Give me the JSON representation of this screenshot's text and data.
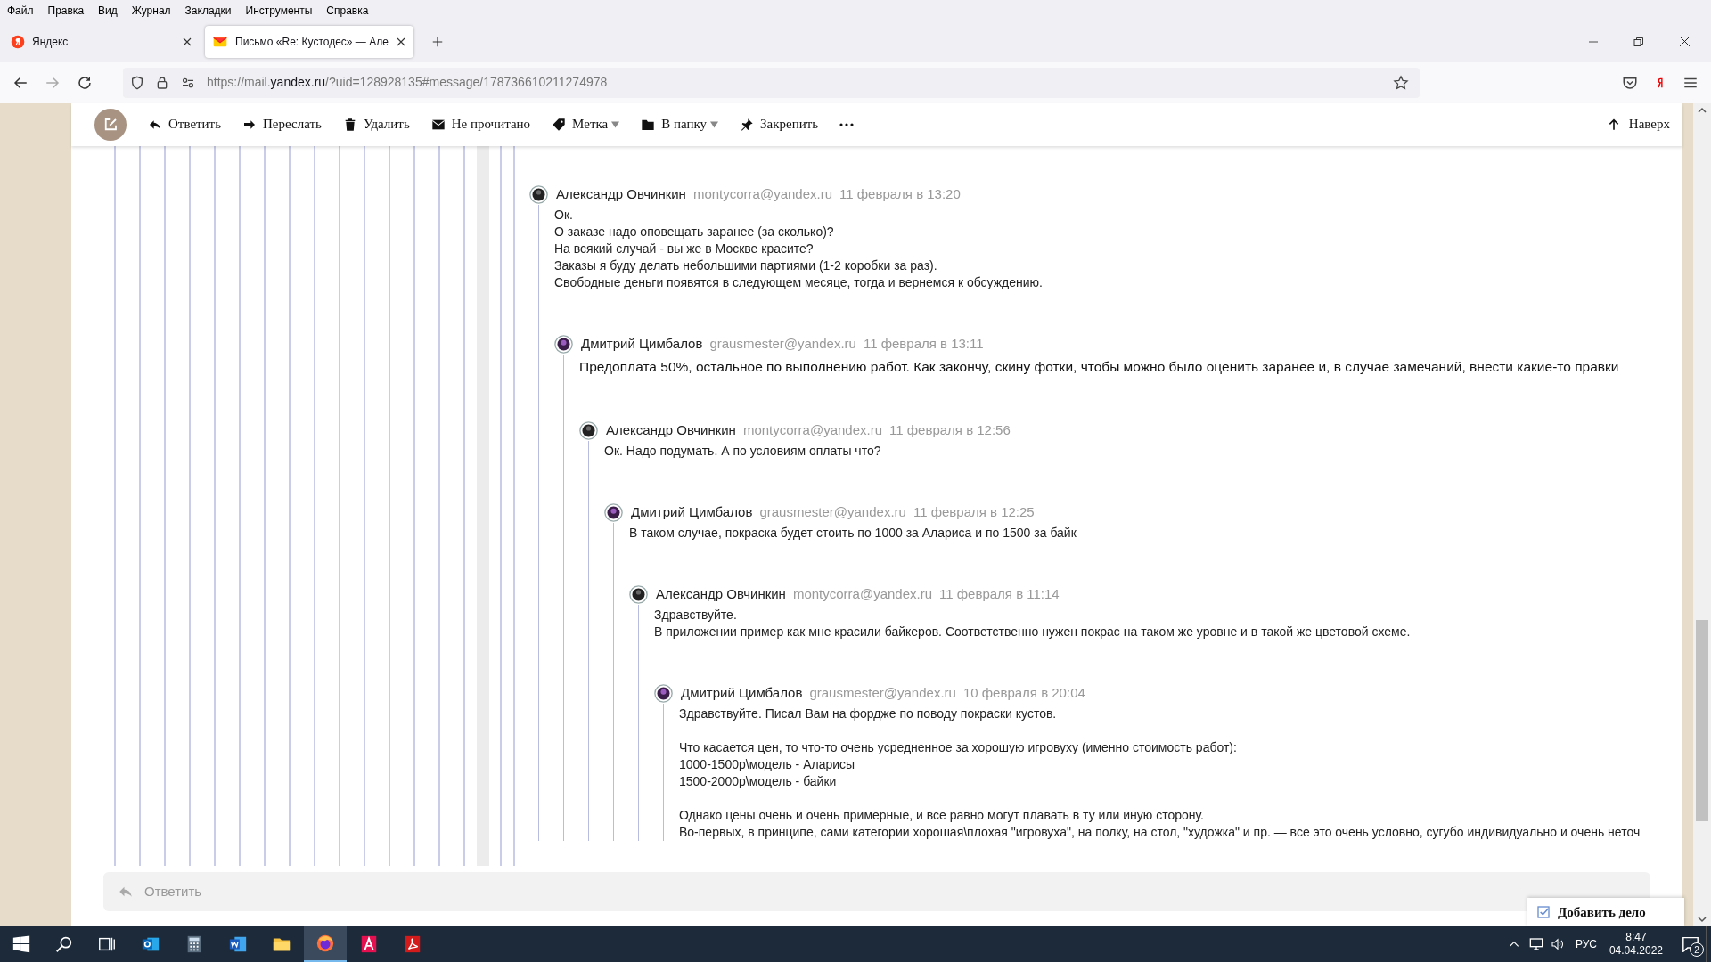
{
  "menu": [
    "Файл",
    "Правка",
    "Вид",
    "Журнал",
    "Закладки",
    "Инструменты",
    "Справка"
  ],
  "tabs": [
    {
      "title": "Яндекс",
      "selected": false
    },
    {
      "title": "Письмо «Re: Кустодес» — Але",
      "selected": true
    }
  ],
  "address": {
    "url_start": "https://mail.",
    "url_domain": "yandex.ru",
    "url_rest": "/?uid=128928135#message/178736610211274978"
  },
  "toolbar": {
    "actions": [
      {
        "label": "Ответить",
        "dropdown": false
      },
      {
        "label": "Переслать",
        "dropdown": false
      },
      {
        "label": "Удалить",
        "dropdown": false
      },
      {
        "label": "Не прочитано",
        "dropdown": false
      },
      {
        "label": "Метка",
        "dropdown": true
      },
      {
        "label": "В папку",
        "dropdown": true
      },
      {
        "label": "Закрепить",
        "dropdown": false
      }
    ],
    "top_label": "Наверх"
  },
  "thread": {
    "author": "Александр Овчинкин",
    "email": "montycorra@yandex.ru",
    "date": "11 февраля в 13:20",
    "large_text": false,
    "paragraphs": [
      [
        "Ок.",
        "О заказе надо оповещать заранее (за сколько)?",
        "На всякий случай - вы же в Москве красите?",
        "Заказы я буду делать небольшими партиями (1-2 коробки за раз).",
        "Свободные деньги появятся в следующем месяце, тогда и вернемся к обсуждению."
      ]
    ],
    "children": [
      {
        "author": "Дмитрий Цимбалов",
        "email": "grausmester@yandex.ru",
        "date": "11 февраля в 13:11",
        "large_text": true,
        "paragraphs": [
          [
            "Предоплата 50%, остальное по выполнению работ. Как закончу, скину фотки, чтобы можно было оценить заранее и, в случае  замечаний, внести какие-то правки"
          ]
        ],
        "children": [
          {
            "author": "Александр Овчинкин",
            "email": "montycorra@yandex.ru",
            "date": "11 февраля в 12:56",
            "large_text": false,
            "paragraphs": [
              [
                "Ок. Надо подумать. А по условиям оплаты что?"
              ]
            ],
            "children": [
              {
                "author": "Дмитрий Цимбалов",
                "email": "grausmester@yandex.ru",
                "date": "11 февраля в 12:25",
                "large_text": false,
                "paragraphs": [
                  [
                    "В таком случае, покраска будет стоить по  1000 за Алариса и по 1500 за байк"
                  ]
                ],
                "children": [
                  {
                    "author": "Александр Овчинкин",
                    "email": "montycorra@yandex.ru",
                    "date": "11 февраля в 11:14",
                    "large_text": false,
                    "paragraphs": [
                      [
                        "Здравствуйте.",
                        "В приложении пример как мне красили байкеров. Соответственно нужен покрас на таком же уровне и в такой же цветовой схеме."
                      ]
                    ],
                    "children": [
                      {
                        "author": "Дмитрий Цимбалов",
                        "email": "grausmester@yandex.ru",
                        "date": "10 февраля в 20:04",
                        "large_text": false,
                        "paragraphs": [
                          [
                            "Здравствуйте. Писал Вам на фордже по поводу покраски кустов."
                          ],
                          [
                            "Что касается цен, то что-то очень усредненное за хорошую игровуху (именно стоимость работ):",
                            "1000-1500р\\модель - Аларисы",
                            "1500-2000р\\модель - байки"
                          ],
                          [
                            "Однако цены очень и очень примерные, и все равно могут плавать в ту или иную сторону.",
                            "Во-первых, в принципе, сами категории хорошая\\плохая \"игровуха\", на полку, на стол, \"художка\" и пр. — все это очень условно, сугубо индивидуально и очень неточ"
                          ]
                        ]
                      }
                    ]
                  }
                ]
              }
            ]
          }
        ]
      }
    ]
  },
  "reply_bar": {
    "placeholder": "Ответить"
  },
  "todo": "Добавить дело",
  "taskbar": {
    "apps": [
      {
        "kind": "outlook",
        "active": false
      },
      {
        "kind": "calculator",
        "active": false
      },
      {
        "kind": "word",
        "active": false
      },
      {
        "kind": "explorer",
        "active": false
      },
      {
        "kind": "firefox",
        "active": true
      },
      {
        "kind": "autocad",
        "active": false
      },
      {
        "kind": "acrobat",
        "active": false
      }
    ],
    "lang": "РУС",
    "time": "8:47",
    "date": "04.04.2022",
    "notifications": "2"
  }
}
